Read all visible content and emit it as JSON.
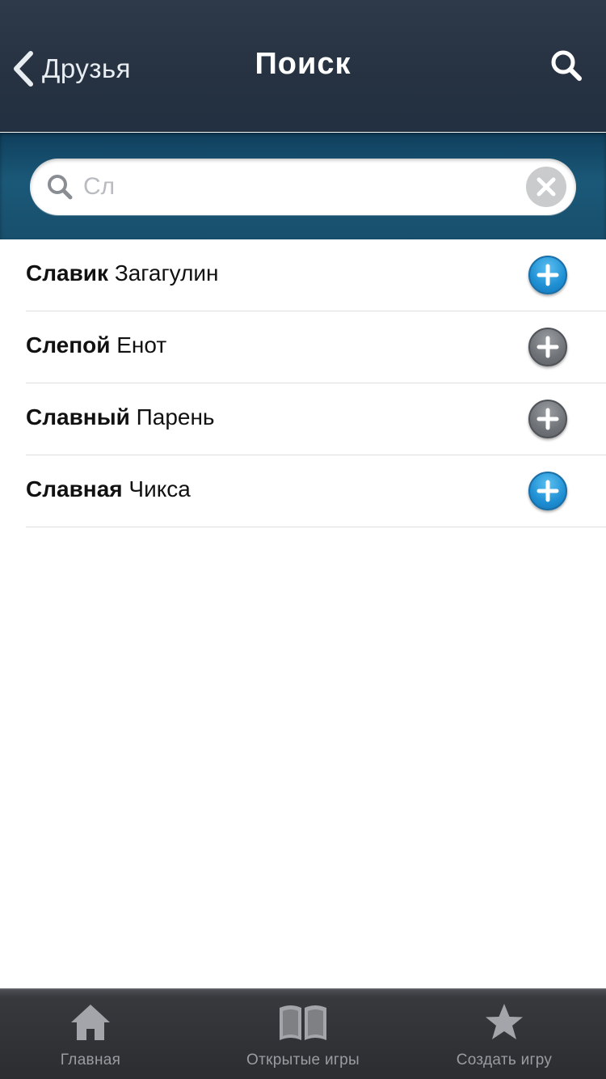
{
  "navbar": {
    "back_label": "Друзья",
    "title": "Поиск"
  },
  "search": {
    "value": "Сл"
  },
  "results": [
    {
      "first": "Славик",
      "last": "Загагулин",
      "add_color": "blue"
    },
    {
      "first": "Слепой",
      "last": "Енот",
      "add_color": "gray"
    },
    {
      "first": "Славный",
      "last": "Парень",
      "add_color": "gray"
    },
    {
      "first": "Славная",
      "last": "Чикса",
      "add_color": "blue"
    }
  ],
  "tabbar": {
    "tabs": [
      {
        "label": "Главная",
        "icon": "home-icon"
      },
      {
        "label": "Открытые игры",
        "icon": "book-icon"
      },
      {
        "label": "Создать игру",
        "icon": "star-icon"
      }
    ]
  },
  "colors": {
    "navbar_bg": "#263241",
    "search_band_bg": "#1b5878",
    "accent_blue": "#1f8fd3",
    "tabbar_bg": "#2c2d31"
  }
}
